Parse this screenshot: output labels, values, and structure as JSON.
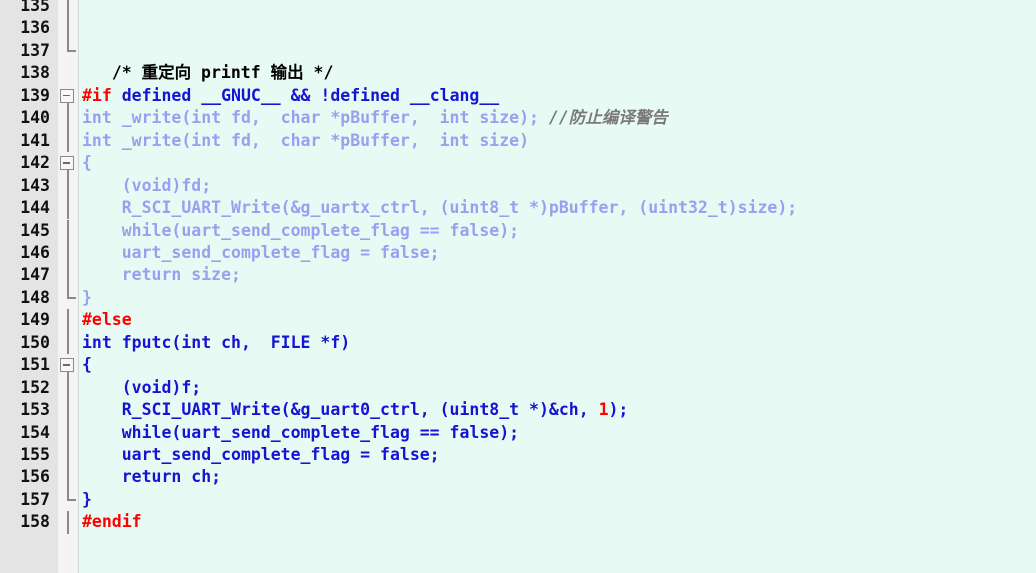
{
  "editor": {
    "title": "source code view",
    "language": "c",
    "colors": {
      "background": "#e8faf4",
      "gutter_background": "#e4e4e4",
      "fold_column_background": "#f4f4f4",
      "line_number": "#111111",
      "code_light_blue": "#9aa0f0",
      "code_dark_blue": "#1414d2",
      "preprocessor_red": "#ff0000",
      "comment_gray": "#7a7a7a",
      "comment_black": "#000000",
      "number_literal_red": "#ff0000"
    },
    "first_visible_line": 135,
    "last_visible_line": 158
  },
  "lines": [
    {
      "no": "135",
      "fold": "line",
      "tokens": []
    },
    {
      "no": "136",
      "fold": "line",
      "tokens": []
    },
    {
      "no": "137",
      "fold": "end",
      "tokens": []
    },
    {
      "no": "138",
      "fold": "none",
      "tokens": [
        {
          "t": "   ",
          "c": "t-black"
        },
        {
          "t": "/* 重定向 printf 输出 */",
          "c": "t-black"
        }
      ]
    },
    {
      "no": "139",
      "fold": "box",
      "tokens": [
        {
          "t": "#if",
          "c": "t-red"
        },
        {
          "t": " defined __GNUC__ && !defined __clang__",
          "c": "t-dark"
        }
      ]
    },
    {
      "no": "140",
      "fold": "line",
      "tokens": [
        {
          "t": "int _write(int fd,  char *pBuffer,  int size);",
          "c": "t-light"
        },
        {
          "t": " ",
          "c": "t-light"
        },
        {
          "t": "//防止编译警告",
          "c": "t-comment"
        }
      ]
    },
    {
      "no": "141",
      "fold": "line",
      "tokens": [
        {
          "t": "int _write(int fd,  char *pBuffer,  int size)",
          "c": "t-light"
        }
      ]
    },
    {
      "no": "142",
      "fold": "box",
      "tokens": [
        {
          "t": "{",
          "c": "t-light"
        }
      ]
    },
    {
      "no": "143",
      "fold": "line",
      "tokens": [
        {
          "t": "    (void)fd;",
          "c": "t-light"
        }
      ]
    },
    {
      "no": "144",
      "fold": "line",
      "tokens": [
        {
          "t": "    R_SCI_UART_Write(&g_uartx_ctrl, (uint8_t *)pBuffer, (uint32_t)size);",
          "c": "t-light"
        }
      ]
    },
    {
      "no": "145",
      "fold": "line",
      "tokens": [
        {
          "t": "    while(uart_send_complete_flag == false);",
          "c": "t-light"
        }
      ]
    },
    {
      "no": "146",
      "fold": "line",
      "tokens": [
        {
          "t": "    uart_send_complete_flag = false;",
          "c": "t-light"
        }
      ]
    },
    {
      "no": "147",
      "fold": "line",
      "tokens": [
        {
          "t": "    return size;",
          "c": "t-light"
        }
      ]
    },
    {
      "no": "148",
      "fold": "end",
      "tokens": [
        {
          "t": "}",
          "c": "t-light"
        }
      ]
    },
    {
      "no": "149",
      "fold": "line",
      "tokens": [
        {
          "t": "#else",
          "c": "t-red"
        }
      ]
    },
    {
      "no": "150",
      "fold": "line",
      "tokens": [
        {
          "t": "int fputc(int ch,  FILE *f)",
          "c": "t-dark"
        }
      ]
    },
    {
      "no": "151",
      "fold": "box",
      "tokens": [
        {
          "t": "{",
          "c": "t-dark"
        }
      ]
    },
    {
      "no": "152",
      "fold": "line",
      "tokens": [
        {
          "t": "    (void)f;",
          "c": "t-dark"
        }
      ]
    },
    {
      "no": "153",
      "fold": "line",
      "tokens": [
        {
          "t": "    R_SCI_UART_Write(&g_uart0_ctrl, (uint8_t *)&ch, ",
          "c": "t-dark"
        },
        {
          "t": "1",
          "c": "t-num"
        },
        {
          "t": ");",
          "c": "t-dark"
        }
      ]
    },
    {
      "no": "154",
      "fold": "line",
      "tokens": [
        {
          "t": "    while(uart_send_complete_flag == false);",
          "c": "t-dark"
        }
      ]
    },
    {
      "no": "155",
      "fold": "line",
      "tokens": [
        {
          "t": "    uart_send_complete_flag = false;",
          "c": "t-dark"
        }
      ]
    },
    {
      "no": "156",
      "fold": "line",
      "tokens": [
        {
          "t": "    return ch;",
          "c": "t-dark"
        }
      ]
    },
    {
      "no": "157",
      "fold": "end",
      "tokens": [
        {
          "t": "}",
          "c": "t-dark"
        }
      ]
    },
    {
      "no": "158",
      "fold": "line",
      "tokens": [
        {
          "t": "#endif",
          "c": "t-red"
        }
      ]
    }
  ]
}
